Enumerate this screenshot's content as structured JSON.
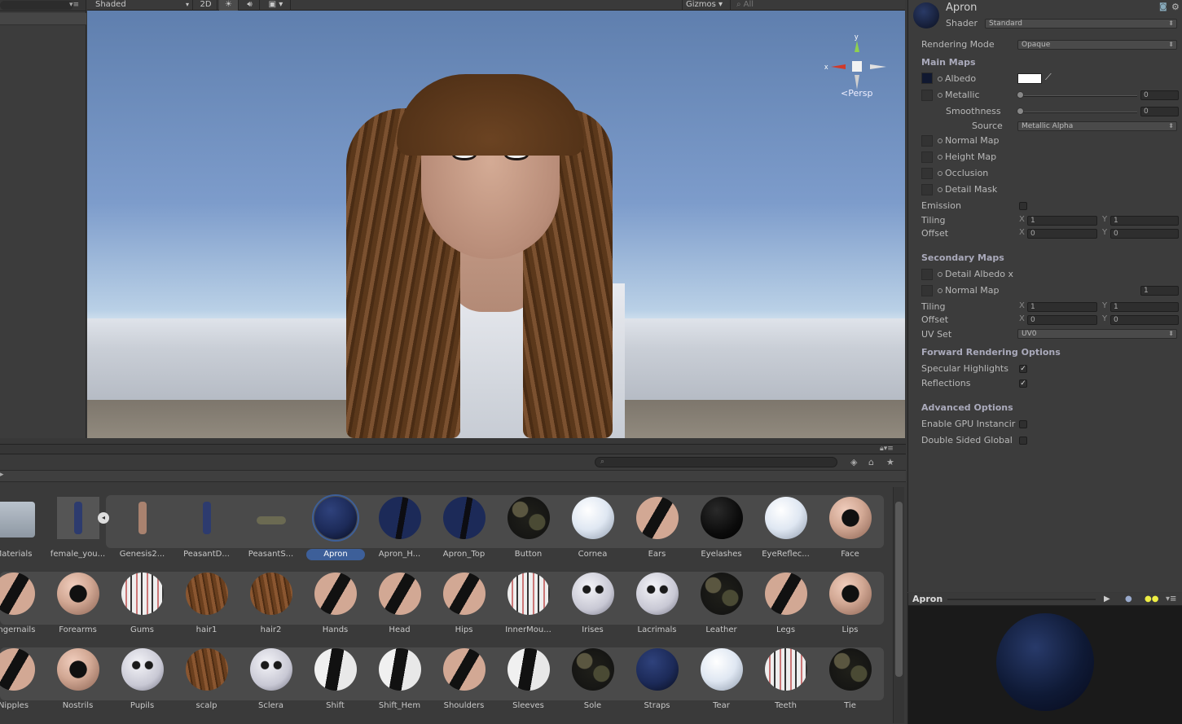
{
  "scene_toolbar": {
    "shading_mode": "Shaded",
    "mode_2d": "2D",
    "gizmos_label": "Gizmos",
    "search_placeholder": "All",
    "persp_label": "Persp",
    "axis_y": "y",
    "axis_x": "x"
  },
  "inspector": {
    "material_name": "Apron",
    "shader_label": "Shader",
    "shader_value": "Standard",
    "rendering_mode_label": "Rendering Mode",
    "rendering_mode_value": "Opaque",
    "main_maps_header": "Main Maps",
    "albedo_label": "Albedo",
    "metallic_label": "Metallic",
    "metallic_value": "0",
    "smoothness_label": "Smoothness",
    "smoothness_value": "0",
    "source_label": "Source",
    "source_value": "Metallic Alpha",
    "normal_map_label": "Normal Map",
    "height_map_label": "Height Map",
    "occlusion_label": "Occlusion",
    "detail_mask_label": "Detail Mask",
    "emission_label": "Emission",
    "tiling_label": "Tiling",
    "offset_label": "Offset",
    "main_tiling_x": "1",
    "main_tiling_y": "1",
    "main_offset_x": "0",
    "main_offset_y": "0",
    "secondary_maps_header": "Secondary Maps",
    "detail_albedo_label": "Detail Albedo x",
    "sec_normal_map_label": "Normal Map",
    "sec_normal_value": "1",
    "sec_tiling_x": "1",
    "sec_tiling_y": "1",
    "sec_offset_x": "0",
    "sec_offset_y": "0",
    "uv_set_label": "UV Set",
    "uv_set_value": "UV0",
    "forward_header": "Forward Rendering Options",
    "specular_label": "Specular Highlights",
    "specular_checked": true,
    "reflections_label": "Reflections",
    "reflections_checked": true,
    "advanced_header": "Advanced Options",
    "gpu_instancing_label": "Enable GPU Instancir",
    "double_sided_label": "Double Sided Global",
    "x_label": "X",
    "y_label": "Y"
  },
  "preview": {
    "title": "Apron"
  },
  "project": {
    "search_placeholder": "",
    "row1": [
      "Materials",
      "female_you...",
      "Genesis2...",
      "PeasantD...",
      "PeasantS...",
      "Apron",
      "Apron_H...",
      "Apron_Top",
      "Button",
      "Cornea",
      "Ears",
      "Eyelashes",
      "EyeReflec...",
      "Face"
    ],
    "row2": [
      "Fingernails",
      "Forearms",
      "Gums",
      "hair1",
      "hair2",
      "Hands",
      "Head",
      "Hips",
      "InnerMou...",
      "Irises",
      "Lacrimals",
      "Leather",
      "Legs",
      "Lips"
    ],
    "row3": [
      "Nipples",
      "Nostrils",
      "Pupils",
      "scalp",
      "Sclera",
      "Shift",
      "Shift_Hem",
      "Shoulders",
      "Sleeves",
      "Sole",
      "Straps",
      "Tear",
      "Teeth",
      "Tie"
    ],
    "selected": "Apron"
  },
  "colors": {
    "selection": "#3d5f99",
    "panel": "#3c3c3c",
    "skin": "#d2a894",
    "navy": "#1c2a58",
    "dark": "#101010"
  }
}
